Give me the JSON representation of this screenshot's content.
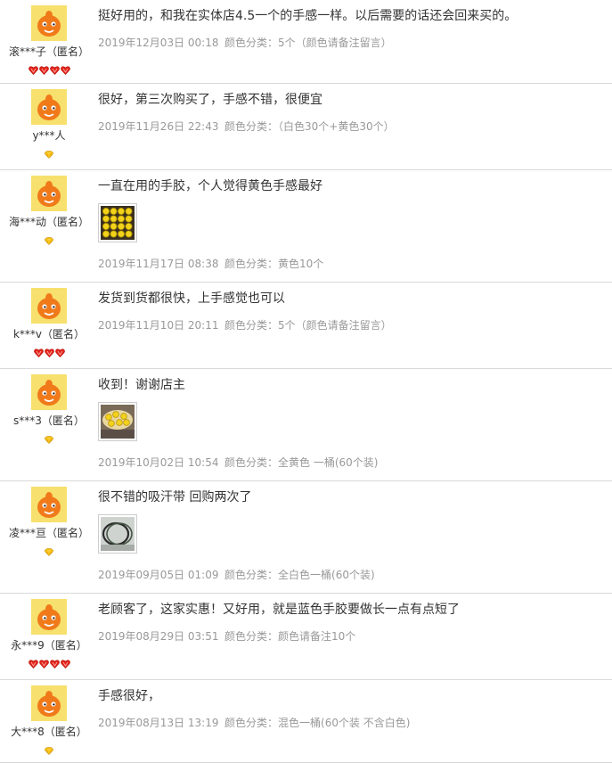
{
  "colors": {
    "border": "#d9d9d9",
    "text": "#333333",
    "meta": "#999999",
    "avatar_bg": "#f7e06d",
    "avatar_fg": "#f07a1a",
    "gem_red": "#e2231a",
    "gem_yellow": "#f5b800"
  },
  "sku_label": "颜色分类：",
  "reviews": [
    {
      "user": "滚***子（匿名）",
      "rank_icon": "red-heart",
      "rank_count": 4,
      "text": "挺好用的，和我在实体店4.5一个的手感一样。以后需要的话还会回来买的。",
      "photo": "",
      "date": "2019年12月03日 00:18",
      "sku": "5个（颜色请备注留言）"
    },
    {
      "user": "y***人",
      "rank_icon": "yellow-gem",
      "rank_count": 1,
      "text": "很好，第三次购买了，手感不错，很便宜",
      "photo": "",
      "date": "2019年11月26日 22:43",
      "sku": "（白色30个+黄色30个）"
    },
    {
      "user": "海***动（匿名）",
      "rank_icon": "yellow-gem",
      "rank_count": 1,
      "text": "一直在用的手胶，个人觉得黄色手感最好",
      "photo": "yellow-grip-rolls",
      "date": "2019年11月17日 08:38",
      "sku": "黄色10个"
    },
    {
      "user": "k***v（匿名）",
      "rank_icon": "red-heart",
      "rank_count": 3,
      "text": "发货到货都很快，上手感觉也可以",
      "photo": "",
      "date": "2019年11月10日 20:11",
      "sku": "5个（颜色请备注留言）"
    },
    {
      "user": "s***3（匿名）",
      "rank_icon": "yellow-gem",
      "rank_count": 1,
      "text": "收到！谢谢店主",
      "photo": "yellow-grip-bucket",
      "date": "2019年10月02日 10:54",
      "sku": "全黄色 一桶(60个装)"
    },
    {
      "user": "凌***亘（匿名）",
      "rank_icon": "yellow-gem",
      "rank_count": 1,
      "text": "很不错的吸汗带 回购两次了",
      "photo": "grip-rings",
      "date": "2019年09月05日 01:09",
      "sku": "全白色一桶(60个装)"
    },
    {
      "user": "永***9（匿名）",
      "rank_icon": "red-heart",
      "rank_count": 4,
      "text": "老顾客了，这家实惠！又好用，就是蓝色手胶要做长一点有点短了",
      "photo": "",
      "date": "2019年08月29日 03:51",
      "sku": "颜色请备注10个"
    },
    {
      "user": "大***8（匿名）",
      "rank_icon": "yellow-gem",
      "rank_count": 1,
      "text": "手感很好，",
      "photo": "",
      "date": "2019年08月13日 13:19",
      "sku": "混色一桶(60个装 不含白色)"
    }
  ]
}
